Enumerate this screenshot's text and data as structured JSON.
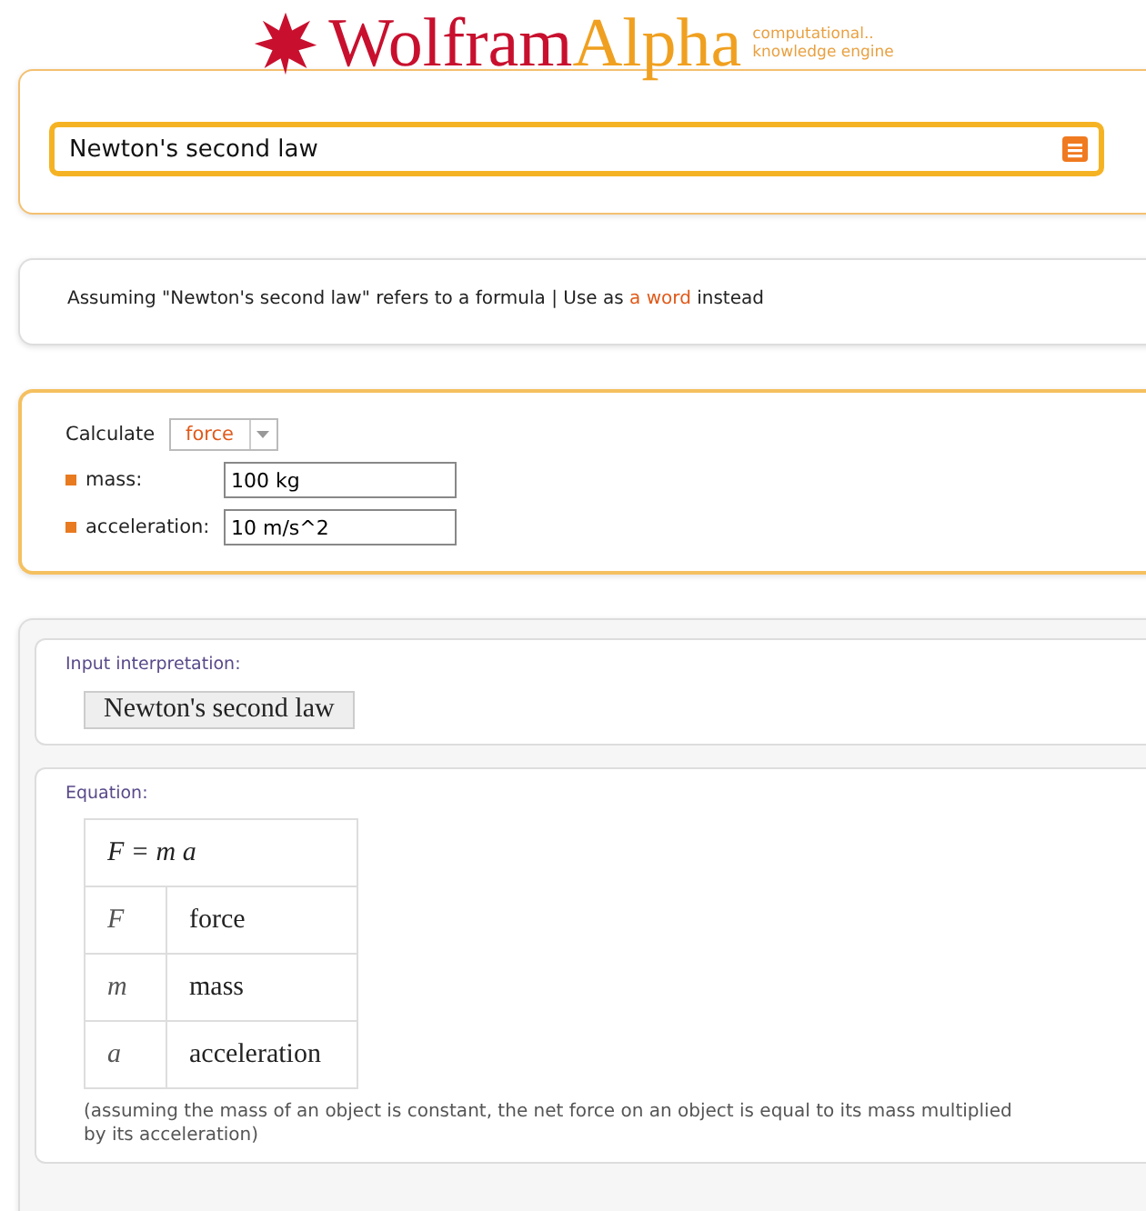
{
  "logo": {
    "brand_first": "Wolfram",
    "brand_second": "Alpha",
    "tagline": [
      "computational..",
      "knowledge engine"
    ]
  },
  "search": {
    "value": "Newton's second law"
  },
  "assumption": {
    "text": "Assuming \"Newton's second law\" refers to a formula | Use as",
    "link": "a word",
    "suffix": "instead"
  },
  "calculate": {
    "label": "Calculate",
    "selected": "force",
    "params": [
      {
        "label": "mass:",
        "value": "100 kg"
      },
      {
        "label": "acceleration:",
        "value": "10 m/s^2"
      }
    ]
  },
  "results": [
    {
      "title": "Input interpretation:",
      "kind": "interpretation",
      "text": "Newton's second law"
    },
    {
      "title": "Equation:",
      "kind": "equation",
      "formula": "F = m a",
      "rows": [
        {
          "symbol": "F",
          "meaning": "force"
        },
        {
          "symbol": "m",
          "meaning": "mass"
        },
        {
          "symbol": "a",
          "meaning": "acceleration"
        }
      ],
      "note": "(assuming the mass of an object is constant, the net force on an object is equal to its mass multiplied by its acceleration)"
    }
  ]
}
